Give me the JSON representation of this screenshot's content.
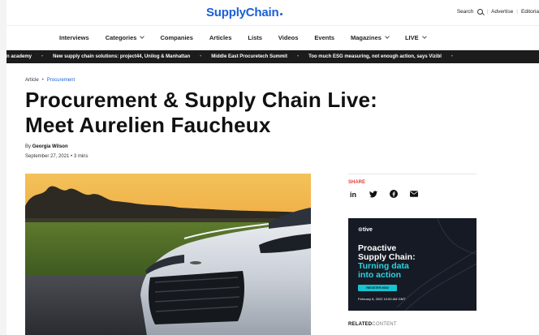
{
  "header": {
    "logo": "SupplyChain",
    "search_label": "Search",
    "advertise": "Advertise",
    "editorial": "Editoria"
  },
  "nav": {
    "items": [
      {
        "label": "Interviews",
        "dropdown": false
      },
      {
        "label": "Categories",
        "dropdown": true
      },
      {
        "label": "Companies",
        "dropdown": false
      },
      {
        "label": "Articles",
        "dropdown": false
      },
      {
        "label": "Lists",
        "dropdown": false
      },
      {
        "label": "Videos",
        "dropdown": false
      },
      {
        "label": "Events",
        "dropdown": false
      },
      {
        "label": "Magazines",
        "dropdown": true
      },
      {
        "label": "LIVE",
        "dropdown": true
      }
    ]
  },
  "ticker": {
    "items": [
      "n academy",
      "New supply chain solutions: project44, Unilog & Manhattan",
      "Middle East Procuretech Summit",
      "Too much ESG measuring, not enough action, says Vizibl"
    ]
  },
  "breadcrumb": {
    "type": "Article",
    "category": "Procurement"
  },
  "article": {
    "title_line1": "Procurement & Supply Chain Live:",
    "title_line2": "Meet Aurelien Faucheux",
    "by_prefix": "By",
    "author": "Georgia Wilson",
    "date": "September 27, 2021",
    "read_time": "3 mins"
  },
  "share": {
    "label": "SHARE",
    "icons": [
      "linkedin-icon",
      "twitter-icon",
      "facebook-icon",
      "email-icon"
    ]
  },
  "ad": {
    "brand": "tive",
    "headline1_a": "Proactive",
    "headline1_b": "Supply Chain:",
    "headline2_a": "Turning data",
    "headline2_b": "into action",
    "button": "REGISTER NOW",
    "date": "February 8, 2022   10:00 AM GMT",
    "colors": {
      "bg": "#161a24",
      "accent": "#29d3e0"
    }
  },
  "related": {
    "bold": "RELATED",
    "light": "CONTENT"
  }
}
